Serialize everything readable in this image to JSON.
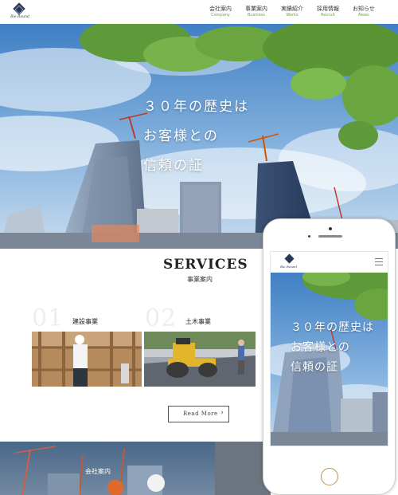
{
  "header": {
    "logo_text": "Rie Round",
    "nav": [
      {
        "jp": "会社案内",
        "en": "Company"
      },
      {
        "jp": "事業案内",
        "en": "Business"
      },
      {
        "jp": "実績紹介",
        "en": "Works"
      },
      {
        "jp": "採用情報",
        "en": "Recruit"
      },
      {
        "jp": "お知らせ",
        "en": "News"
      }
    ],
    "accent_color": "#6aa53f"
  },
  "hero": {
    "lines": [
      "３０年の歴史は",
      "お客様との",
      "信頼の証"
    ]
  },
  "services": {
    "title": "SERVICES",
    "subtitle": "事業案内",
    "items": [
      {
        "number": "01",
        "label": "建設事業"
      },
      {
        "number": "02",
        "label": "土木事業"
      }
    ],
    "read_more": "Read More",
    "read_more_icon": "chevron-right-icon"
  },
  "company": {
    "label": "会社案内"
  },
  "phone": {
    "logo_text": "Rie Round",
    "menu_icon": "hamburger-icon",
    "hero_lines": [
      "３０年の歴史は",
      "お客様との",
      "信頼の証"
    ]
  }
}
